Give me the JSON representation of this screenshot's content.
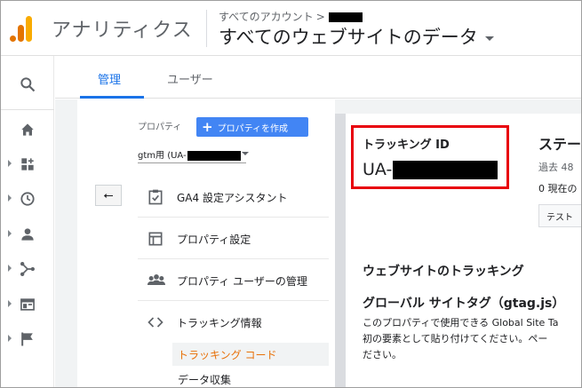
{
  "header": {
    "app_title": "アナリティクス",
    "breadcrumb": "すべてのアカウント",
    "breadcrumb_sep": ">",
    "view_title": "すべてのウェブサイトのデータ"
  },
  "tabs": [
    {
      "label": "管理",
      "active": true
    },
    {
      "label": "ユーザー",
      "active": false
    }
  ],
  "property": {
    "label": "プロパティ",
    "create_button": "プロパティを作成",
    "create_plus": "+",
    "selected": "gtm用 (UA-"
  },
  "back_button": "⭠",
  "menu": [
    {
      "label": "GA4 設定アシスタント",
      "icon": "checklist-icon"
    },
    {
      "label": "プロパティ設定",
      "icon": "layout-icon"
    },
    {
      "label": "プロパティ ユーザーの管理",
      "icon": "people-icon"
    },
    {
      "label": "トラッキング情報",
      "icon": "code-icon"
    }
  ],
  "submenu": [
    {
      "label": "トラッキング コード",
      "active": true
    },
    {
      "label": "データ収集",
      "active": false
    }
  ],
  "tracking": {
    "title": "トラッキング ID",
    "id_prefix": "UA-"
  },
  "status": {
    "title": "ステー",
    "past": "過去 48",
    "now": "0 現在の",
    "test_button": "テスト"
  },
  "website_tracking": {
    "title": "ウェブサイトのトラッキング",
    "gtag_title": "グローバル サイトタグ（gtag.js）",
    "desc_lines": [
      "このプロパティで使用できる Global Site Ta",
      "初の要素として貼り付けてください。ペー",
      "ださい。"
    ]
  },
  "colors": {
    "accent": "#1a73e8",
    "active_sub": "#e8710a",
    "highlight_box": "#e8000b",
    "create_button": "#4285f4",
    "logo_dark": "#e37400",
    "logo_light": "#f9ab00"
  },
  "rail_icons": [
    "search-icon",
    "home-icon",
    "customization-icon",
    "realtime-icon",
    "audience-icon",
    "acquisition-icon",
    "behavior-icon",
    "conversions-icon"
  ]
}
